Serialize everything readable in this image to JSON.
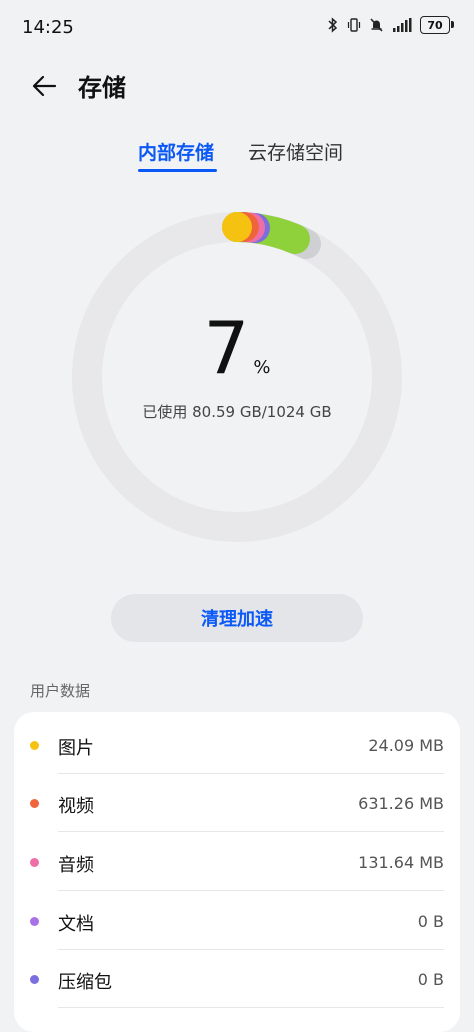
{
  "status_bar": {
    "time": "14:25",
    "battery": "70"
  },
  "header": {
    "title": "存储"
  },
  "tabs": [
    {
      "label": "内部存储",
      "active": true
    },
    {
      "label": "云存储空间",
      "active": false
    }
  ],
  "storage": {
    "percent": "7",
    "percent_sign": "%",
    "used_text": "已使用 80.59 GB/1024 GB",
    "used_fraction": 0.07
  },
  "clean_button": {
    "label": "清理加速"
  },
  "section": {
    "title": "用户数据"
  },
  "items": [
    {
      "label": "图片",
      "size": "24.09 MB",
      "color": "#f5c211"
    },
    {
      "label": "视频",
      "size": "631.26 MB",
      "color": "#f0643c"
    },
    {
      "label": "音频",
      "size": "131.64 MB",
      "color": "#ee6fa7"
    },
    {
      "label": "文档",
      "size": "0 B",
      "color": "#a872e6"
    },
    {
      "label": "压缩包",
      "size": "0 B",
      "color": "#7b6fe0"
    }
  ],
  "colors": {
    "accent": "#0a59f7",
    "apps_segment": "#8fd13a",
    "other_segment": "#c8c9cd",
    "track": "#e8e8ea"
  }
}
